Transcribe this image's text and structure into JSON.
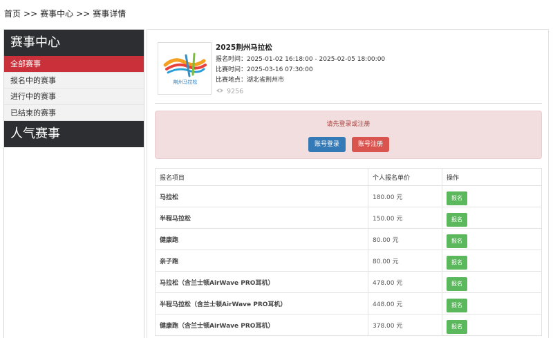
{
  "breadcrumb": {
    "items": [
      "首页",
      "赛事中心",
      "赛事详情"
    ],
    "separator": ">>"
  },
  "sidebar": {
    "title": "赛事中心",
    "items": [
      {
        "label": "全部赛事",
        "active": true
      },
      {
        "label": "报名中的赛事",
        "active": false
      },
      {
        "label": "进行中的赛事",
        "active": false
      },
      {
        "label": "已结束的赛事",
        "active": false
      }
    ],
    "popular_title": "人气赛事"
  },
  "event": {
    "title": "2025荆州马拉松",
    "register_time": "报名时间：2025-01-02 16:18:00 - 2025-02-05 18:00:00",
    "race_time": "比赛时间：2025-03-16 07:30:00",
    "location": "比赛地点：湖北省荆州市",
    "views": "9256",
    "logo_caption": "荆州马拉松"
  },
  "alert": {
    "message": "请先登录或注册",
    "login_label": "账号登录",
    "register_label": "账号注册"
  },
  "table": {
    "headers": [
      "报名项目",
      "个人报名单价",
      "操作"
    ],
    "action_label": "报名",
    "rows": [
      {
        "item": "马拉松",
        "price": "180.00 元"
      },
      {
        "item": "半程马拉松",
        "price": "150.00 元"
      },
      {
        "item": "健康跑",
        "price": "80.00 元"
      },
      {
        "item": "亲子跑",
        "price": "80.00 元"
      },
      {
        "item": "马拉松（含兰士顿AirWave PRO耳机）",
        "price": "478.00 元"
      },
      {
        "item": "半程马拉松（含兰士顿AirWave PRO耳机）",
        "price": "448.00 元"
      },
      {
        "item": "健康跑（含兰士顿AirWave PRO耳机）",
        "price": "378.00 元"
      }
    ]
  },
  "colors": {
    "accent_red": "#c9303a",
    "dark": "#2c2e31",
    "primary": "#337ab7",
    "danger": "#d9534f",
    "success": "#5cb85c"
  },
  "icons": {
    "views": "eye-icon"
  }
}
